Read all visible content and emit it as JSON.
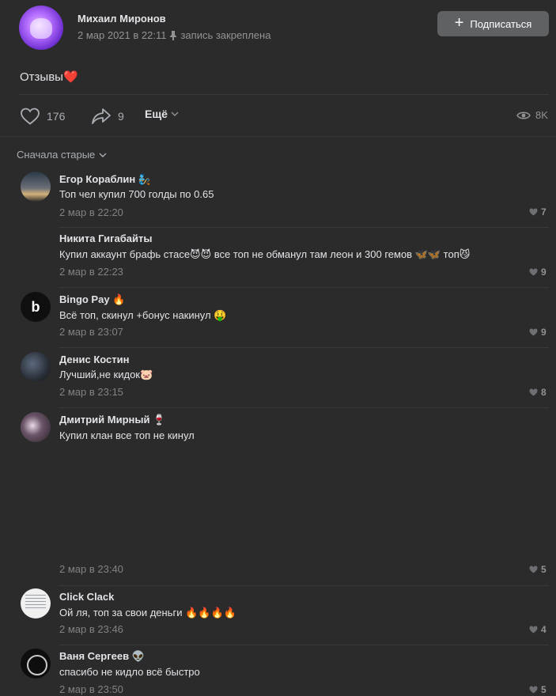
{
  "post": {
    "author": "Михаил Миронов",
    "date": "2 мар 2021 в 22:11",
    "pinned_label": "запись закреплена",
    "subscribe_label": "Подписаться",
    "text": "Отзывы",
    "text_emoji": "❤️",
    "likes": "176",
    "shares": "9",
    "more_label": "Ещё",
    "views": "8K"
  },
  "sort_label": "Сначала старые",
  "comments": [
    {
      "name": "Егор Кораблин",
      "name_emoji": "🧞",
      "text": "Топ чел купил 700 голды по 0.65",
      "date": "2 мар в 22:20",
      "likes": "7"
    },
    {
      "name": "Никита Гигабайты",
      "name_emoji": "",
      "text": "Купил аккаунт брафь стасе😈😈 все топ не обманул там леон и 300 гемов 🦋🦋 топ😼",
      "date": "2 мар в 22:23",
      "likes": "9"
    },
    {
      "name": "Bingo Pay",
      "name_emoji": "🔥",
      "text": "Всё топ, скинул +бонус накинул 🤑",
      "date": "2 мар в 23:07",
      "likes": "9"
    },
    {
      "name": "Денис Костин",
      "name_emoji": "",
      "text": "Лучший,не кидок🐷",
      "date": "2 мар в 23:15",
      "likes": "8"
    },
    {
      "name": "Дмитрий Мирный",
      "name_emoji": "🍷",
      "text": "Купил клан все топ не кинул",
      "date": "2 мар в 23:40",
      "likes": "5"
    },
    {
      "name": "Click Clack",
      "name_emoji": "",
      "text": "Ой ля, топ за свои деньги 🔥🔥🔥🔥",
      "date": "2 мар в 23:46",
      "likes": "4"
    },
    {
      "name": "Ваня Сергеев",
      "name_emoji": "👽",
      "text": "спасибо не кидло всё быстро",
      "date": "2 мар в 23:50",
      "likes": "5"
    }
  ],
  "colors": {
    "background": "#2b2b2c",
    "button": "#5f6163",
    "secondary_text": "#828282"
  }
}
